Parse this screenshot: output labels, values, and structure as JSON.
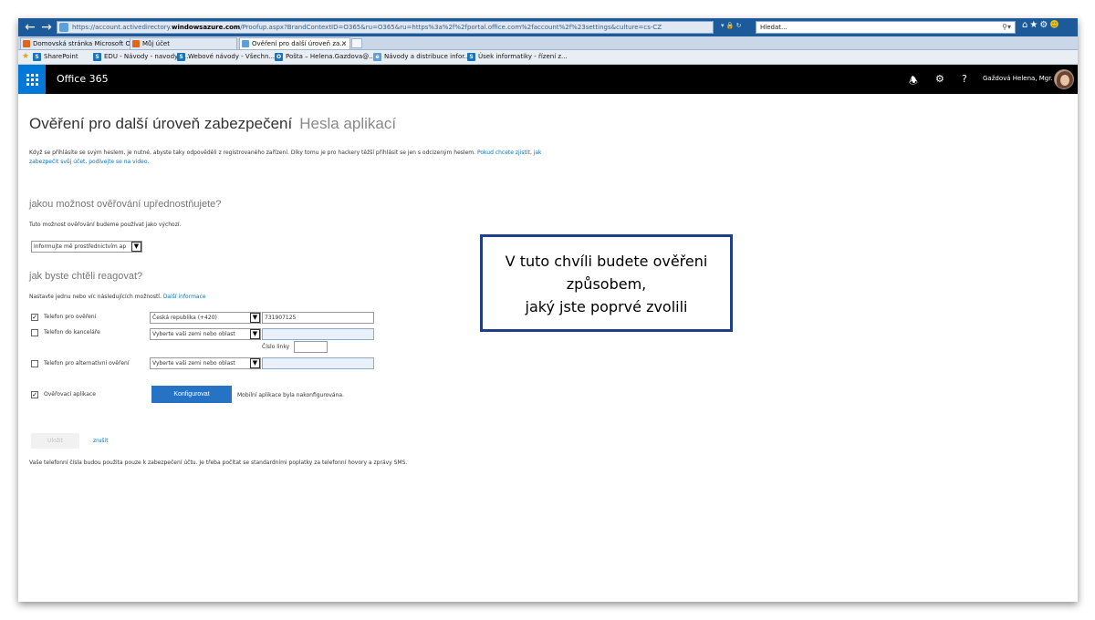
{
  "browser": {
    "url_prefix": "https://account.activedirectory.",
    "url_domain": "windowsazure.com",
    "url_rest": "/Proofup.aspx?BrandContextID=O365&ru=O365&ru=https%3a%2f%2fportal.office.com%2faccount%2f%23settings&culture=cs-CZ",
    "search_placeholder": "Hledat...",
    "tabs": [
      {
        "label": "Domovská stránka Microsoft O...",
        "icon_color": "#e0641c"
      },
      {
        "label": "Můj účet",
        "icon_color": "#e0641c"
      },
      {
        "label": "Ověření pro další úroveň za...",
        "icon_color": "#5aa0dc",
        "active": true
      }
    ],
    "favorites": [
      {
        "label": "SharePoint",
        "icon": "S",
        "color": "#1b73b8"
      },
      {
        "label": "EDU - Návody - navody-h...",
        "icon": "S",
        "color": "#1b73b8"
      },
      {
        "label": "Webové návody - Všechn...",
        "icon": "S",
        "color": "#1b73b8"
      },
      {
        "label": "Pošta – Helena.Gazdova@...",
        "icon": "O",
        "color": "#1b73b8"
      },
      {
        "label": "Návody a distribuce infor...",
        "icon": "e",
        "color": "#5aa0dc"
      },
      {
        "label": "Úsek informatiky - řízení z...",
        "icon": "S",
        "color": "#1b73b8"
      }
    ]
  },
  "header": {
    "app_title": "Office 365",
    "user_name": "Gaždová Helena, Mgr."
  },
  "page": {
    "title": "Ověření pro další úroveň zabezpečení",
    "title_tab": "Hesla aplikací",
    "intro_text": "Když se přihlásíte se svým heslem, je nutné, abyste taky odpověděli z registrovaného zařízení. Díky tomu je pro hackery těžší přihlásit se jen s odcizeným heslem. ",
    "intro_link": "Pokud chcete zjistit, jak zabezpečit svůj účet, podívejte se na video.",
    "pref_heading": "jakou možnost ověřování upřednostňujete?",
    "pref_note": "Tuto možnost ověřování budeme používat jako výchozí.",
    "pref_select": "Informujte mě prostřednictvím ap",
    "respond_heading": "jak byste chtěli reagovat?",
    "respond_note": "Nastavte jednu nebo víc následujících možností.",
    "respond_link": "Další informace",
    "options": {
      "auth_phone": {
        "label": "Telefon pro ověření",
        "checked": true,
        "country": "Česká republika (+420)",
        "number": "731907125"
      },
      "office_phone": {
        "label": "Telefon do kanceláře",
        "checked": false,
        "country": "Vyberte vaši zemi nebo oblast",
        "number": ""
      },
      "extension_label": "Číslo linky",
      "alt_phone": {
        "label": "Telefon pro alternativní ověření",
        "checked": false,
        "country": "Vyberte vaši zemi nebo oblast",
        "number": ""
      },
      "auth_app": {
        "label": "Ověřovací aplikace",
        "checked": true,
        "button": "Konfigurovat",
        "status": "Mobilní aplikace byla nakonfigurována."
      }
    },
    "save_label": "Uložit",
    "cancel_label": "zrušit",
    "footnote": "Vaše telefonní čísla budou použita pouze k zabezpečení účtu. Je třeba počítat se standardními poplatky za telefonní hovory a zprávy SMS."
  },
  "callout": {
    "text": "V tuto chvíli budete ověřeni\nzpůsobem,\njaký jste poprvé zvolili"
  },
  "colors": {
    "accent": "#0078d7",
    "button": "#2672c5",
    "callout_border": "#1d3f8c"
  }
}
